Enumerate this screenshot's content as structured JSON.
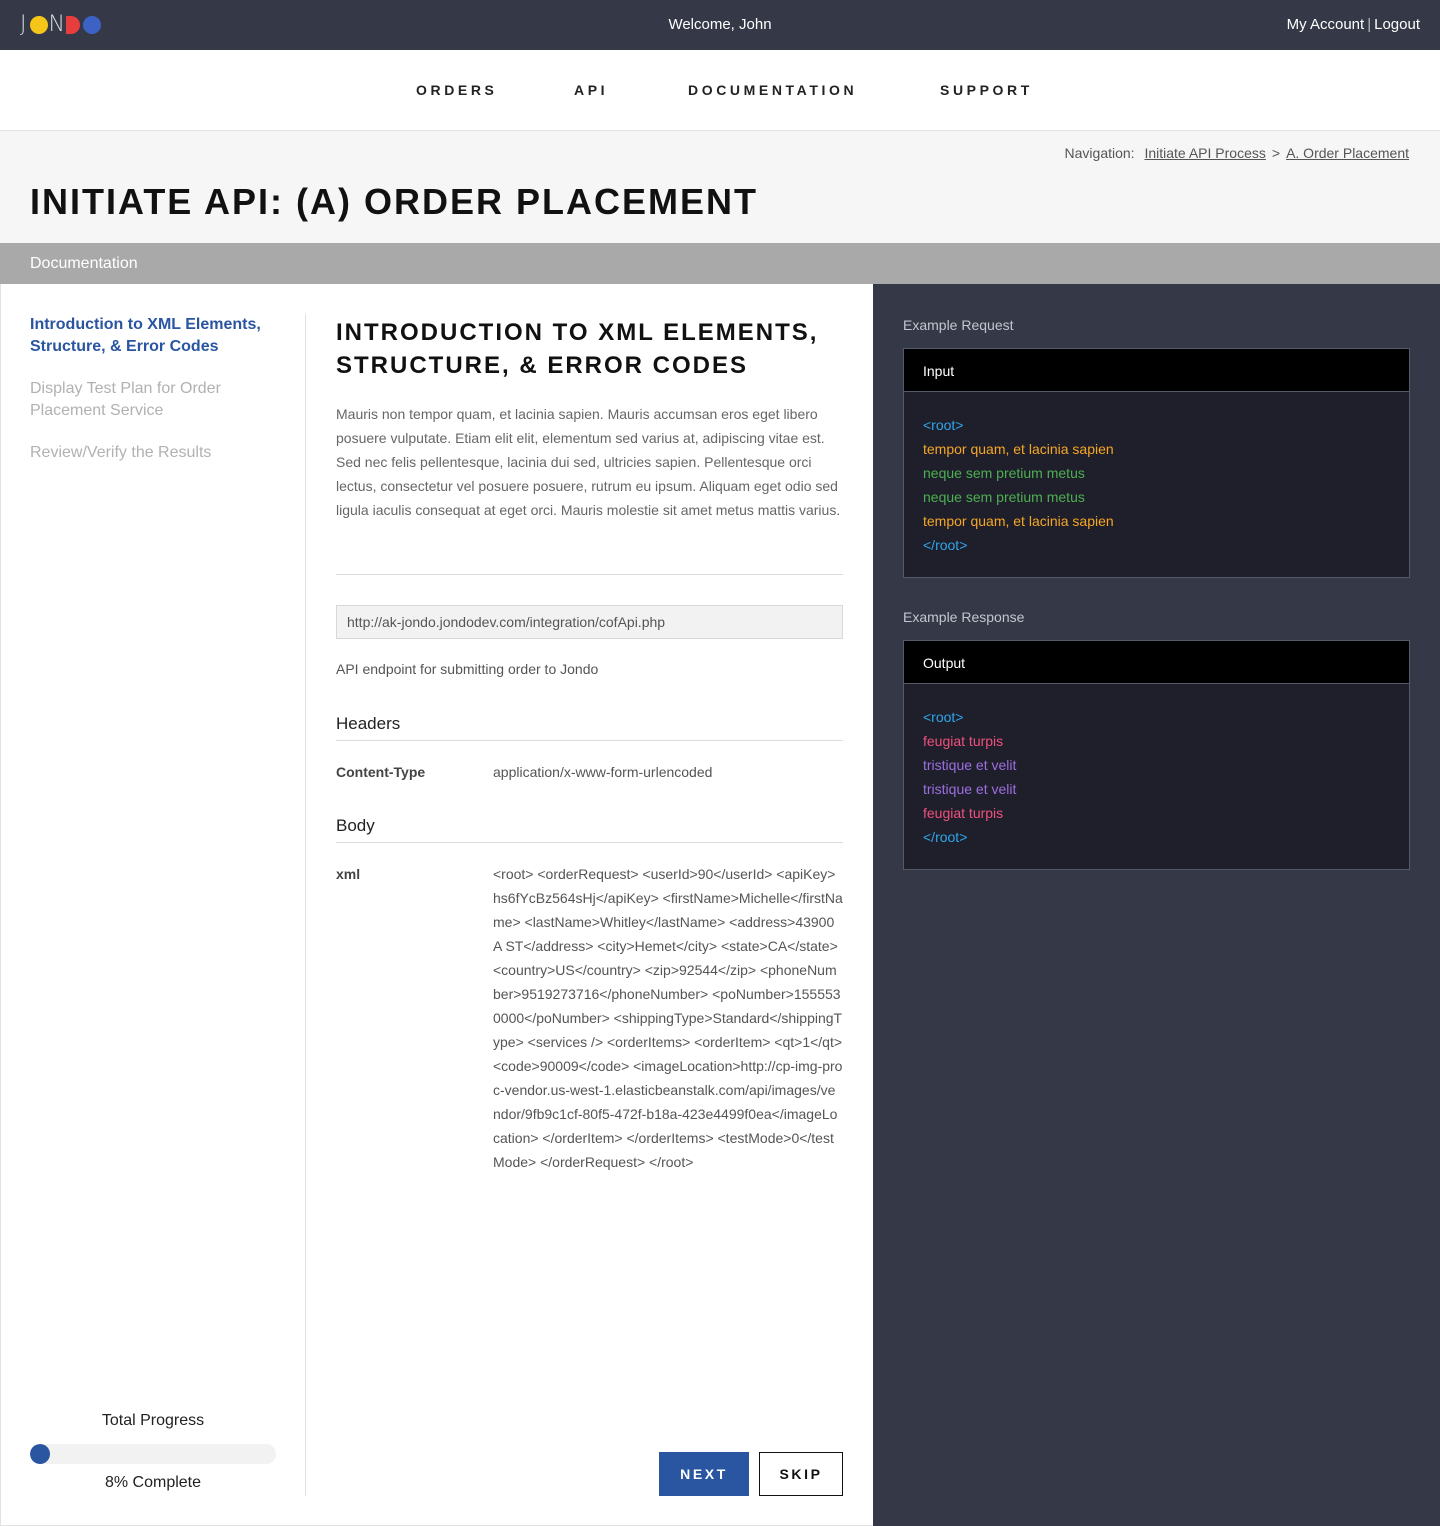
{
  "topbar": {
    "logo_text": "JONDO",
    "welcome": "Welcome, John",
    "my_account": "My Account",
    "separator": "|",
    "logout": "Logout"
  },
  "nav": {
    "items": [
      "ORDERS",
      "API",
      "DOCUMENTATION",
      "SUPPORT"
    ]
  },
  "breadcrumb": {
    "prefix": "Navigation:",
    "items": [
      "Initiate API Process",
      "A. Order Placement"
    ],
    "separator": ">"
  },
  "page": {
    "title": "INITIATE API: (A) ORDER PLACEMENT",
    "section_bar": "Documentation"
  },
  "sidebar": {
    "steps": [
      {
        "label": "Introduction to XML Elements, Structure, & Error Codes",
        "active": true
      },
      {
        "label": "Display Test Plan for Order Placement Service",
        "active": false
      },
      {
        "label": "Review/Verify the Results",
        "active": false
      }
    ],
    "progress": {
      "label": "Total Progress",
      "value": 0.08,
      "text": "8% Complete"
    }
  },
  "content": {
    "heading": "INTRODUCTION TO XML ELEMENTS, STRUCTURE, & ERROR CODES",
    "paragraph": "Mauris non tempor quam, et lacinia sapien. Mauris accumsan eros eget libero posuere vulputate. Etiam elit elit, elementum sed varius at, adipiscing vitae est. Sed nec felis pellentesque, lacinia dui sed, ultricies sapien. Pellentesque orci lectus, consectetur vel posuere posuere, rutrum eu ipsum. Aliquam eget odio sed ligula iaculis consequat at eget orci. Mauris molestie sit amet metus mattis varius.",
    "endpoint_url": "http://ak-jondo.jondodev.com/integration/cofApi.php",
    "endpoint_desc": "API endpoint for submitting order to Jondo",
    "headers_title": "Headers",
    "header_key": "Content-Type",
    "header_value": "application/x-www-form-urlencoded",
    "body_title": "Body",
    "body_key": "xml",
    "body_value": "<root> <orderRequest> <userId>90</userId> <apiKey>hs6fYcBz564sHj</apiKey> <firstName>Michelle</firstName> <lastName>Whitley</lastName> <address>43900 A ST</address> <city>Hemet</city> <state>CA</state> <country>US</country> <zip>92544</zip> <phoneNumber>9519273716</phoneNumber> <poNumber>1555530000</poNumber> <shippingType>Standard</shippingType> <services /> <orderItems> <orderItem> <qt>1</qt> <code>90009</code> <imageLocation>http://cp-img-proc-vendor.us-west-1.elasticbeanstalk.com/api/images/vendor/9fb9c1cf-80f5-472f-b18a-423e4499f0ea</imageLocation> </orderItem> </orderItems> <testMode>0</testMode> </orderRequest> </root>",
    "next_label": "NEXT",
    "skip_label": "SKIP"
  },
  "examples": {
    "request_label": "Example Request",
    "request_head": "Input",
    "request_lines": [
      {
        "text": "<root>",
        "color": "#2fa6ea"
      },
      {
        "text": "tempor quam, et lacinia sapien",
        "color": "#f5a623"
      },
      {
        "text": "neque sem pretium metus",
        "color": "#4caf50"
      },
      {
        "text": "neque sem pretium metus",
        "color": "#4caf50"
      },
      {
        "text": "tempor quam, et lacinia sapien",
        "color": "#f5a623"
      },
      {
        "text": "</root>",
        "color": "#2fa6ea"
      }
    ],
    "response_label": "Example Response",
    "response_head": "Output",
    "response_lines": [
      {
        "text": "<root>",
        "color": "#2fa6ea"
      },
      {
        "text": "feugiat turpis",
        "color": "#f0507c"
      },
      {
        "text": "tristique et velit",
        "color": "#9c6fe0"
      },
      {
        "text": "tristique et velit",
        "color": "#9c6fe0"
      },
      {
        "text": "feugiat turpis",
        "color": "#f0507c"
      },
      {
        "text": "</root>",
        "color": "#2fa6ea"
      }
    ]
  },
  "colors": {
    "topbar_bg": "#343847",
    "accent": "#2a55a1",
    "dark_panel": "#343847"
  }
}
